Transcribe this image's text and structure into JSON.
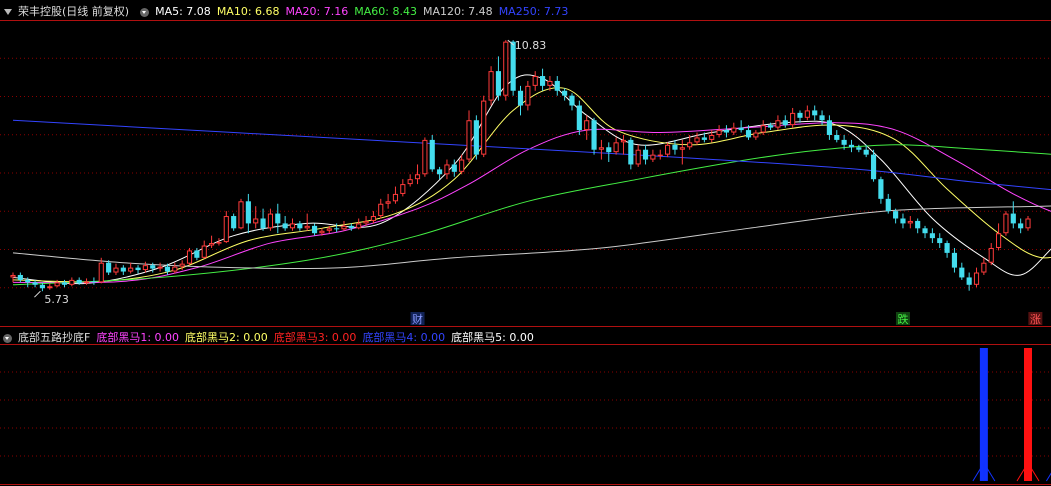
{
  "legend_main": {
    "title": "荣丰控股(日线 前复权)",
    "items": [
      {
        "label": "MA5: 7.08",
        "color": "#ffffff"
      },
      {
        "label": "MA10: 6.68",
        "color": "#ffff66"
      },
      {
        "label": "MA20: 7.16",
        "color": "#ff44ff"
      },
      {
        "label": "MA60: 8.43",
        "color": "#44ee44"
      },
      {
        "label": "MA120: 7.48",
        "color": "#cccccc"
      },
      {
        "label": "MA250: 7.73",
        "color": "#3344ff"
      }
    ]
  },
  "legend_sub": {
    "title": "底部五路抄底F",
    "items": [
      {
        "label": "底部黑马1: 0.00",
        "color": "#ff44ff"
      },
      {
        "label": "底部黑马2: 0.00",
        "color": "#ffff66"
      },
      {
        "label": "底部黑马3: 0.00",
        "color": "#ff2222"
      },
      {
        "label": "底部黑马4: 0.00",
        "color": "#3344ff"
      },
      {
        "label": "底部黑马5: 0.00",
        "color": "#ffffff"
      }
    ]
  },
  "colors": {
    "up": "#ff3b3b",
    "down": "#44ddee",
    "grid": "#8a0000",
    "frame": "#b01010"
  },
  "chart_data": {
    "type": "candlestick",
    "price_range": [
      5.5,
      11.2
    ],
    "annotations": {
      "high_label": "10.83",
      "low_label": "5.73"
    },
    "event_markers": [
      {
        "bar": 55,
        "text": "财",
        "color": "#8899ff",
        "bg": "#112255"
      },
      {
        "bar": 121,
        "text": "跌",
        "color": "#44ee44",
        "bg": "#114411"
      },
      {
        "bar": 139,
        "text": "涨",
        "color": "#ff5555",
        "bg": "#551111"
      }
    ],
    "candles": [
      [
        6.0,
        6.05,
        5.9,
        6.1
      ],
      [
        6.05,
        5.95,
        5.9,
        6.1
      ],
      [
        5.95,
        5.9,
        5.8,
        6.0
      ],
      [
        5.9,
        5.85,
        5.8,
        5.95
      ],
      [
        5.85,
        5.78,
        5.72,
        5.9
      ],
      [
        5.78,
        5.82,
        5.75,
        5.88
      ],
      [
        5.82,
        5.9,
        5.8,
        5.95
      ],
      [
        5.9,
        5.85,
        5.8,
        5.95
      ],
      [
        5.85,
        5.95,
        5.82,
        6.0
      ],
      [
        5.95,
        5.88,
        5.85,
        6.0
      ],
      [
        5.88,
        5.92,
        5.85,
        5.98
      ],
      [
        5.92,
        5.9,
        5.85,
        6.0
      ],
      [
        5.9,
        6.3,
        5.88,
        6.4
      ],
      [
        6.3,
        6.1,
        6.05,
        6.35
      ],
      [
        6.1,
        6.2,
        6.05,
        6.28
      ],
      [
        6.2,
        6.12,
        6.05,
        6.25
      ],
      [
        6.12,
        6.2,
        6.08,
        6.3
      ],
      [
        6.2,
        6.15,
        6.08,
        6.25
      ],
      [
        6.15,
        6.25,
        6.1,
        6.32
      ],
      [
        6.25,
        6.18,
        6.1,
        6.3
      ],
      [
        6.18,
        6.22,
        6.12,
        6.3
      ],
      [
        6.22,
        6.12,
        6.05,
        6.28
      ],
      [
        6.12,
        6.22,
        6.08,
        6.3
      ],
      [
        6.22,
        6.28,
        6.15,
        6.35
      ],
      [
        6.28,
        6.55,
        6.25,
        6.6
      ],
      [
        6.55,
        6.4,
        6.35,
        6.6
      ],
      [
        6.4,
        6.65,
        6.38,
        6.75
      ],
      [
        6.65,
        6.7,
        6.6,
        6.85
      ],
      [
        6.7,
        6.72,
        6.65,
        6.8
      ],
      [
        6.72,
        7.25,
        6.7,
        7.35
      ],
      [
        7.25,
        7.0,
        6.95,
        7.3
      ],
      [
        7.0,
        7.55,
        6.98,
        7.6
      ],
      [
        7.55,
        7.1,
        6.9,
        7.7
      ],
      [
        7.1,
        7.2,
        7.0,
        7.45
      ],
      [
        7.2,
        7.0,
        6.95,
        7.4
      ],
      [
        7.0,
        7.3,
        6.95,
        7.4
      ],
      [
        7.3,
        7.1,
        6.9,
        7.5
      ],
      [
        7.1,
        7.0,
        6.95,
        7.25
      ],
      [
        7.0,
        7.1,
        6.95,
        7.2
      ],
      [
        7.1,
        7.0,
        6.95,
        7.15
      ],
      [
        7.0,
        7.05,
        6.95,
        7.3
      ],
      [
        7.05,
        6.9,
        6.85,
        7.1
      ],
      [
        6.9,
        6.95,
        6.85,
        7.0
      ],
      [
        6.95,
        7.0,
        6.9,
        7.05
      ],
      [
        7.0,
        6.98,
        6.92,
        7.1
      ],
      [
        6.98,
        7.05,
        6.95,
        7.15
      ],
      [
        7.05,
        7.0,
        6.95,
        7.1
      ],
      [
        7.0,
        7.1,
        6.98,
        7.2
      ],
      [
        7.1,
        7.15,
        7.05,
        7.25
      ],
      [
        7.15,
        7.25,
        7.1,
        7.35
      ],
      [
        7.25,
        7.5,
        7.2,
        7.6
      ],
      [
        7.5,
        7.55,
        7.4,
        7.7
      ],
      [
        7.55,
        7.7,
        7.5,
        7.85
      ],
      [
        7.7,
        7.9,
        7.65,
        8.0
      ],
      [
        7.9,
        8.0,
        7.85,
        8.1
      ],
      [
        8.0,
        8.1,
        7.9,
        8.3
      ],
      [
        8.1,
        8.8,
        8.05,
        8.85
      ],
      [
        8.8,
        8.2,
        8.15,
        8.9
      ],
      [
        8.2,
        8.1,
        8.0,
        8.25
      ],
      [
        8.1,
        8.3,
        8.0,
        8.4
      ],
      [
        8.3,
        8.15,
        8.05,
        8.4
      ],
      [
        8.15,
        8.4,
        8.1,
        8.5
      ],
      [
        8.4,
        9.2,
        8.35,
        9.4
      ],
      [
        9.2,
        8.5,
        8.4,
        9.3
      ],
      [
        8.5,
        9.6,
        8.45,
        9.7
      ],
      [
        9.6,
        10.2,
        9.5,
        10.3
      ],
      [
        10.2,
        9.7,
        9.6,
        10.5
      ],
      [
        9.7,
        10.8,
        9.6,
        10.83
      ],
      [
        10.8,
        9.8,
        9.7,
        10.83
      ],
      [
        9.8,
        9.5,
        9.3,
        9.9
      ],
      [
        9.5,
        9.9,
        9.4,
        10.0
      ],
      [
        9.9,
        10.1,
        9.8,
        10.2
      ],
      [
        10.1,
        9.9,
        9.8,
        10.25
      ],
      [
        9.9,
        10.0,
        9.8,
        10.1
      ],
      [
        10.0,
        9.8,
        9.7,
        10.1
      ],
      [
        9.8,
        9.7,
        9.6,
        9.85
      ],
      [
        9.7,
        9.5,
        9.4,
        9.75
      ],
      [
        9.5,
        9.0,
        8.9,
        9.6
      ],
      [
        9.0,
        9.2,
        8.8,
        9.3
      ],
      [
        9.2,
        8.6,
        8.5,
        9.25
      ],
      [
        8.6,
        8.65,
        8.4,
        8.8
      ],
      [
        8.65,
        8.55,
        8.35,
        8.75
      ],
      [
        8.55,
        8.75,
        8.5,
        8.85
      ],
      [
        8.75,
        8.8,
        8.5,
        8.9
      ],
      [
        8.8,
        8.3,
        8.2,
        8.85
      ],
      [
        8.3,
        8.6,
        8.25,
        8.7
      ],
      [
        8.6,
        8.4,
        8.3,
        8.7
      ],
      [
        8.4,
        8.5,
        8.35,
        8.6
      ],
      [
        8.5,
        8.5,
        8.4,
        8.6
      ],
      [
        8.5,
        8.7,
        8.45,
        8.75
      ],
      [
        8.7,
        8.6,
        8.5,
        8.8
      ],
      [
        8.6,
        8.65,
        8.3,
        8.8
      ],
      [
        8.65,
        8.75,
        8.6,
        8.9
      ],
      [
        8.75,
        8.85,
        8.7,
        8.95
      ],
      [
        8.85,
        8.8,
        8.75,
        8.95
      ],
      [
        8.8,
        8.9,
        8.75,
        9.0
      ],
      [
        8.9,
        9.0,
        8.85,
        9.1
      ],
      [
        9.0,
        8.95,
        8.85,
        9.1
      ],
      [
        8.95,
        9.05,
        8.9,
        9.15
      ],
      [
        9.05,
        9.0,
        8.95,
        9.2
      ],
      [
        9.0,
        8.85,
        8.8,
        9.1
      ],
      [
        8.85,
        8.95,
        8.8,
        9.0
      ],
      [
        8.95,
        9.1,
        8.9,
        9.2
      ],
      [
        9.1,
        9.05,
        9.0,
        9.15
      ],
      [
        9.05,
        9.2,
        9.0,
        9.3
      ],
      [
        9.2,
        9.1,
        9.05,
        9.3
      ],
      [
        9.1,
        9.35,
        9.05,
        9.45
      ],
      [
        9.35,
        9.25,
        9.15,
        9.4
      ],
      [
        9.25,
        9.4,
        9.2,
        9.5
      ],
      [
        9.4,
        9.3,
        9.2,
        9.5
      ],
      [
        9.3,
        9.2,
        9.1,
        9.4
      ],
      [
        9.2,
        8.9,
        8.8,
        9.3
      ],
      [
        8.9,
        8.8,
        8.75,
        9.0
      ],
      [
        8.8,
        8.7,
        8.6,
        8.9
      ],
      [
        8.7,
        8.65,
        8.55,
        8.8
      ],
      [
        8.65,
        8.6,
        8.55,
        8.7
      ],
      [
        8.6,
        8.5,
        8.45,
        8.7
      ],
      [
        8.5,
        8.0,
        7.95,
        8.6
      ],
      [
        8.0,
        7.6,
        7.5,
        8.05
      ],
      [
        7.6,
        7.35,
        7.3,
        7.7
      ],
      [
        7.35,
        7.2,
        7.1,
        7.4
      ],
      [
        7.2,
        7.1,
        7.0,
        7.3
      ],
      [
        7.1,
        7.15,
        7.0,
        7.25
      ],
      [
        7.15,
        7.0,
        6.9,
        7.2
      ],
      [
        7.0,
        6.9,
        6.8,
        7.05
      ],
      [
        6.9,
        6.8,
        6.7,
        7.0
      ],
      [
        6.8,
        6.7,
        6.6,
        6.9
      ],
      [
        6.7,
        6.5,
        6.4,
        6.75
      ],
      [
        6.5,
        6.2,
        6.1,
        6.6
      ],
      [
        6.2,
        6.0,
        5.95,
        6.3
      ],
      [
        6.0,
        5.85,
        5.73,
        6.1
      ],
      [
        5.85,
        6.1,
        5.8,
        6.2
      ],
      [
        6.1,
        6.3,
        6.05,
        6.4
      ],
      [
        6.3,
        6.6,
        6.25,
        6.7
      ],
      [
        6.6,
        6.9,
        6.55,
        7.1
      ],
      [
        6.9,
        7.3,
        6.85,
        7.35
      ],
      [
        7.3,
        7.1,
        7.0,
        7.55
      ],
      [
        7.1,
        7.0,
        6.9,
        7.2
      ],
      [
        7.0,
        7.2,
        6.95,
        7.25
      ]
    ],
    "ma_lines": [
      {
        "name": "MA5",
        "color": "#ffffff",
        "points": [
          [
            0,
            6.0
          ],
          [
            10,
            5.88
          ],
          [
            20,
            6.2
          ],
          [
            30,
            6.85
          ],
          [
            40,
            7.1
          ],
          [
            50,
            7.1
          ],
          [
            60,
            8.3
          ],
          [
            67,
            9.9
          ],
          [
            72,
            10.05
          ],
          [
            78,
            9.3
          ],
          [
            85,
            8.7
          ],
          [
            95,
            8.95
          ],
          [
            105,
            9.15
          ],
          [
            112,
            9.1
          ],
          [
            118,
            8.4
          ],
          [
            125,
            7.2
          ],
          [
            132,
            6.4
          ],
          [
            137,
            6.05
          ],
          [
            142,
            6.7
          ],
          [
            146,
            7.1
          ]
        ]
      },
      {
        "name": "MA10",
        "color": "#ffff66",
        "points": [
          [
            0,
            5.95
          ],
          [
            12,
            5.92
          ],
          [
            22,
            6.15
          ],
          [
            32,
            6.75
          ],
          [
            42,
            7.0
          ],
          [
            52,
            7.3
          ],
          [
            60,
            8.0
          ],
          [
            68,
            9.4
          ],
          [
            75,
            9.85
          ],
          [
            82,
            9.0
          ],
          [
            92,
            8.7
          ],
          [
            102,
            8.95
          ],
          [
            112,
            9.1
          ],
          [
            120,
            8.8
          ],
          [
            127,
            7.8
          ],
          [
            134,
            6.9
          ],
          [
            140,
            6.4
          ],
          [
            146,
            6.7
          ]
        ]
      },
      {
        "name": "MA20",
        "color": "#ff44ff",
        "points": [
          [
            0,
            5.9
          ],
          [
            15,
            5.92
          ],
          [
            25,
            6.2
          ],
          [
            35,
            6.7
          ],
          [
            45,
            6.95
          ],
          [
            55,
            7.4
          ],
          [
            62,
            7.9
          ],
          [
            70,
            8.6
          ],
          [
            78,
            9.0
          ],
          [
            88,
            8.95
          ],
          [
            100,
            9.05
          ],
          [
            112,
            9.15
          ],
          [
            120,
            9.0
          ],
          [
            128,
            8.4
          ],
          [
            136,
            7.7
          ],
          [
            142,
            7.3
          ],
          [
            146,
            7.2
          ]
        ]
      },
      {
        "name": "MA60",
        "color": "#44ee44",
        "points": [
          [
            0,
            5.85
          ],
          [
            20,
            6.0
          ],
          [
            40,
            6.35
          ],
          [
            55,
            6.85
          ],
          [
            70,
            7.55
          ],
          [
            85,
            8.0
          ],
          [
            100,
            8.4
          ],
          [
            110,
            8.6
          ],
          [
            120,
            8.7
          ],
          [
            130,
            8.62
          ],
          [
            140,
            8.52
          ],
          [
            146,
            8.45
          ]
        ]
      },
      {
        "name": "MA120",
        "color": "#cccccc",
        "points": [
          [
            0,
            6.5
          ],
          [
            15,
            6.3
          ],
          [
            30,
            6.2
          ],
          [
            45,
            6.2
          ],
          [
            60,
            6.4
          ],
          [
            80,
            6.6
          ],
          [
            100,
            7.0
          ],
          [
            115,
            7.3
          ],
          [
            125,
            7.4
          ],
          [
            140,
            7.45
          ],
          [
            146,
            7.48
          ]
        ]
      },
      {
        "name": "MA250",
        "color": "#3344ff",
        "points": [
          [
            0,
            9.2
          ],
          [
            30,
            8.95
          ],
          [
            60,
            8.7
          ],
          [
            90,
            8.45
          ],
          [
            115,
            8.2
          ],
          [
            130,
            7.95
          ],
          [
            146,
            7.72
          ]
        ]
      }
    ],
    "signal_bars": [
      {
        "bar": 132,
        "color": "#1133ff",
        "value": 1
      },
      {
        "bar": 138,
        "color": "#ff1111",
        "value": 1
      },
      {
        "bar": 142,
        "color": "#1133ff",
        "value": 1
      }
    ]
  }
}
